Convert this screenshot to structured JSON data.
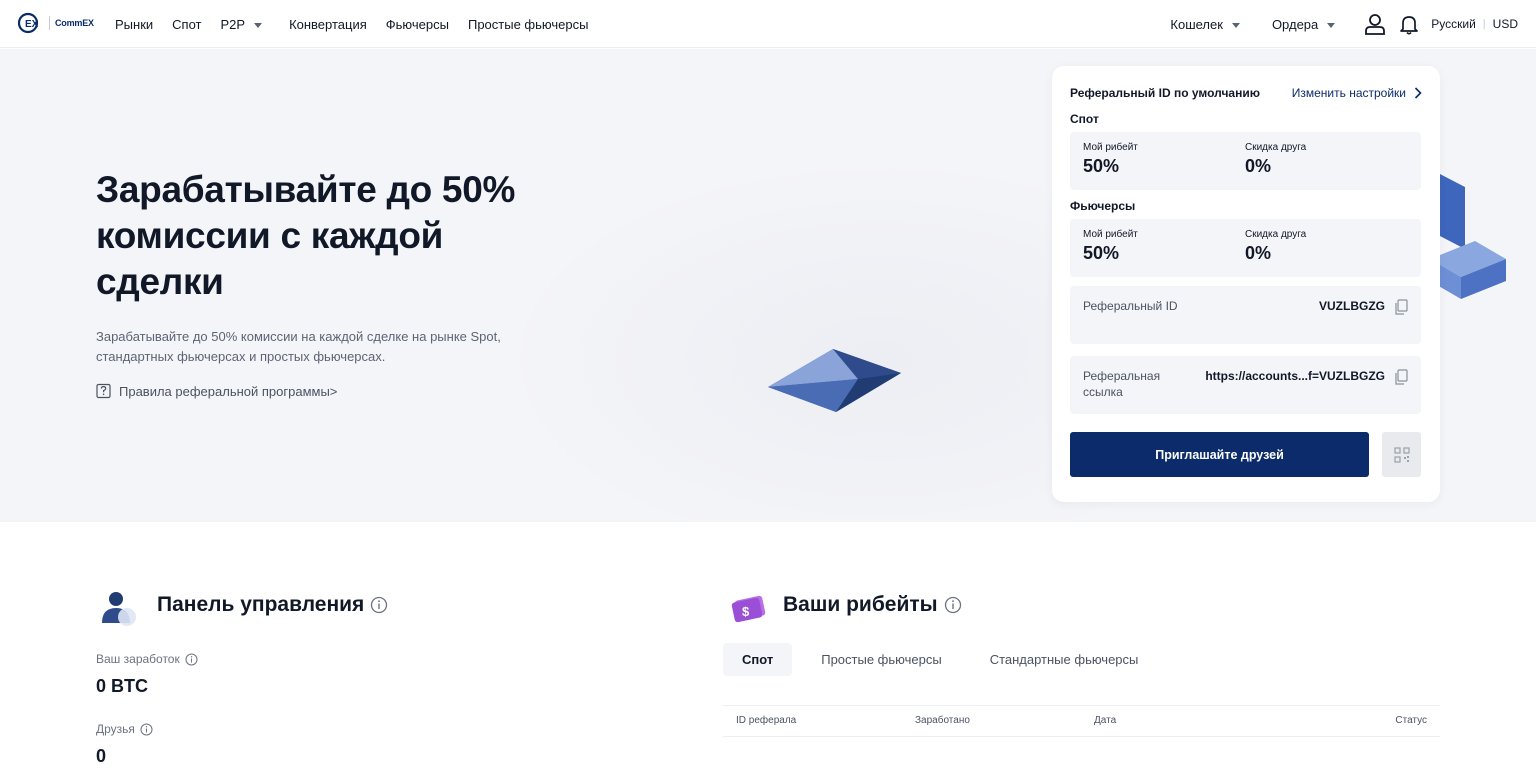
{
  "brand": {
    "logo_text": "CommEX",
    "accent": "#0b2b6b"
  },
  "nav": {
    "left": [
      {
        "label": "Рынки"
      },
      {
        "label": "Спот"
      },
      {
        "label": "P2P",
        "dropdown": true
      },
      {
        "label": "Конвертация"
      },
      {
        "label": "Фьючерсы"
      },
      {
        "label": "Простые фьючерсы"
      }
    ],
    "wallet": "Кошелек",
    "orders": "Ордера",
    "language": "Русский",
    "currency": "USD"
  },
  "hero": {
    "title": "Зарабатывайте до 50% комиссии с каждой сделки",
    "subtitle": "Зарабатывайте до 50% комиссии на каждой сделке на рынке Spot, стандартных фьючерсах и простых фьючерсах.",
    "rules_link": "Правила реферальной программы>"
  },
  "referral_card": {
    "title": "Реферальный ID по умолчанию",
    "settings_link": "Изменить настройки",
    "spot": {
      "label": "Спот",
      "my_rebate_label": "Мой рибейт",
      "my_rebate": "50%",
      "friend_discount_label": "Скидка друга",
      "friend_discount": "0%"
    },
    "futures": {
      "label": "Фьючерсы",
      "my_rebate_label": "Мой рибейт",
      "my_rebate": "50%",
      "friend_discount_label": "Скидка друга",
      "friend_discount": "0%"
    },
    "referral_id_label": "Реферальный ID",
    "referral_id": "VUZLBGZG",
    "referral_link_label": "Реферальная ссылка",
    "referral_link": "https://accounts...f=VUZLBGZG",
    "invite_button": "Приглашайте друзей"
  },
  "dashboard": {
    "title": "Панель управления",
    "earnings_label": "Ваш заработок",
    "earnings": "0 BTC",
    "friends_label": "Друзья",
    "friends": "0"
  },
  "rebates": {
    "title": "Ваши рибейты",
    "tabs": [
      {
        "label": "Спот",
        "active": true
      },
      {
        "label": "Простые фьючерсы",
        "active": false
      },
      {
        "label": "Стандартные фьючерсы",
        "active": false
      }
    ],
    "columns": [
      "ID реферала",
      "Заработано",
      "Дата",
      "Статус"
    ]
  }
}
